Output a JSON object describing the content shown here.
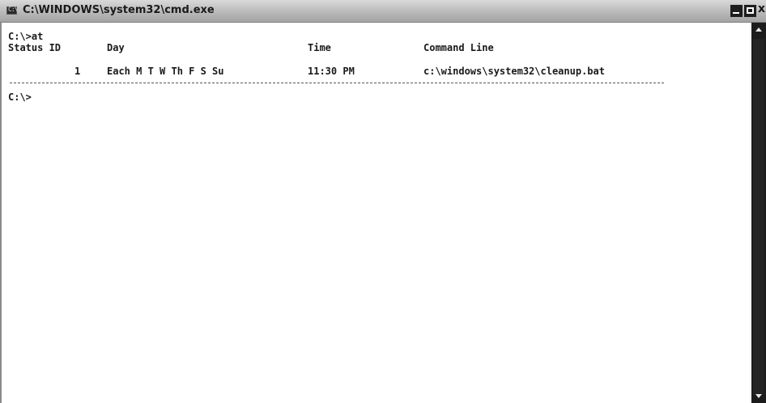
{
  "window": {
    "title": "C:\\WINDOWS\\system32\\cmd.exe",
    "icon": "console-icon",
    "icon_glyph": "C:\\",
    "buttons": {
      "minimize_icon": "minimize-icon",
      "maximize_icon": "maximize-icon",
      "close_icon": "close-icon",
      "close_glyph": "x"
    }
  },
  "console": {
    "command_line": "C:\\>at",
    "table": {
      "headers": {
        "status_id": "Status ID",
        "day": "Day",
        "time": "Time",
        "command_line": "Command Line"
      },
      "rows": [
        {
          "id": "1",
          "day": "Each M T W Th F S Su",
          "time": "11:30 PM",
          "command": "c:\\windows\\system32\\cleanup.bat"
        }
      ]
    },
    "prompt": "C:\\>"
  },
  "colors": {
    "background": "#ffffff",
    "text": "#1a1a1a",
    "scrollbar": "#1c1c1c",
    "titlebar": "#b9b9b9"
  }
}
